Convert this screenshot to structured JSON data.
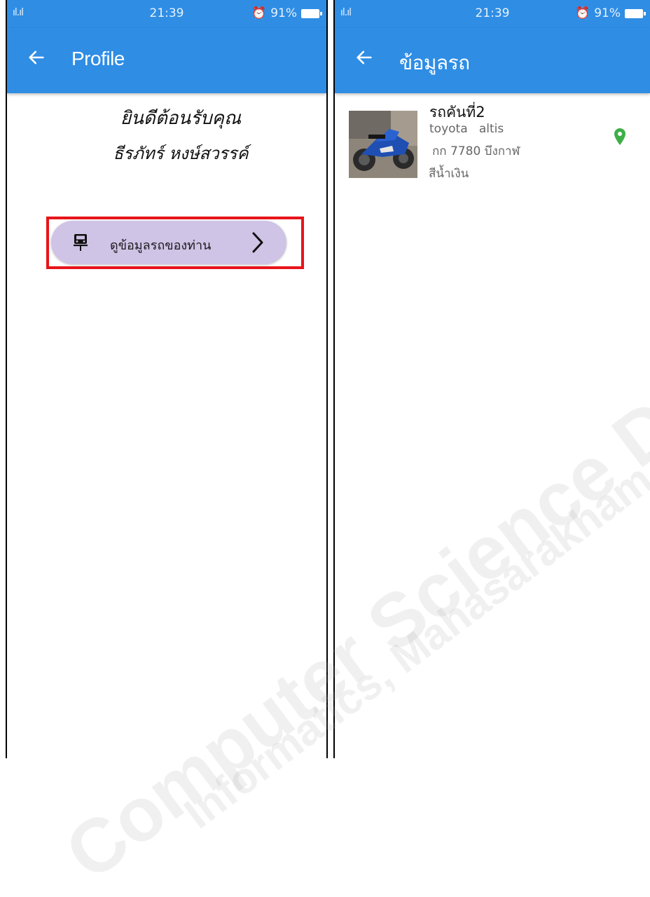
{
  "left_screen": {
    "status_bar": {
      "signal": "ıl.ıl",
      "time": "21:39",
      "battery": "91%"
    },
    "app_bar": {
      "title": "Profile"
    },
    "greeting": {
      "line1": "ยินดีต้อนรับคุณ",
      "line2": "ธีรภัทร์ หงษ์สวรรค์"
    },
    "vehicle_button": {
      "label": "ดูข้อมูลรถของท่าน",
      "icon": "car-icon"
    }
  },
  "right_screen": {
    "status_bar": {
      "signal": "ıl.ıl",
      "time": "21:39",
      "battery": "91%"
    },
    "app_bar": {
      "title": "ข้อมูลรถ"
    },
    "vehicles": [
      {
        "title": "รถคันที่2",
        "brand_model": "toyota   altis",
        "plate": "กก 7780 บึงกาฬ",
        "color": "สีน้ำเงิน",
        "action_icon": "location-pin-icon"
      }
    ]
  },
  "watermark": {
    "line1": "Computer Science Department",
    "line2": "Informatics, Mahasarakham University"
  },
  "colors": {
    "app_bar": "#2f8de4",
    "button_bg": "#cfc3e6",
    "highlight": "#e8141a",
    "pin": "#3fae49"
  }
}
